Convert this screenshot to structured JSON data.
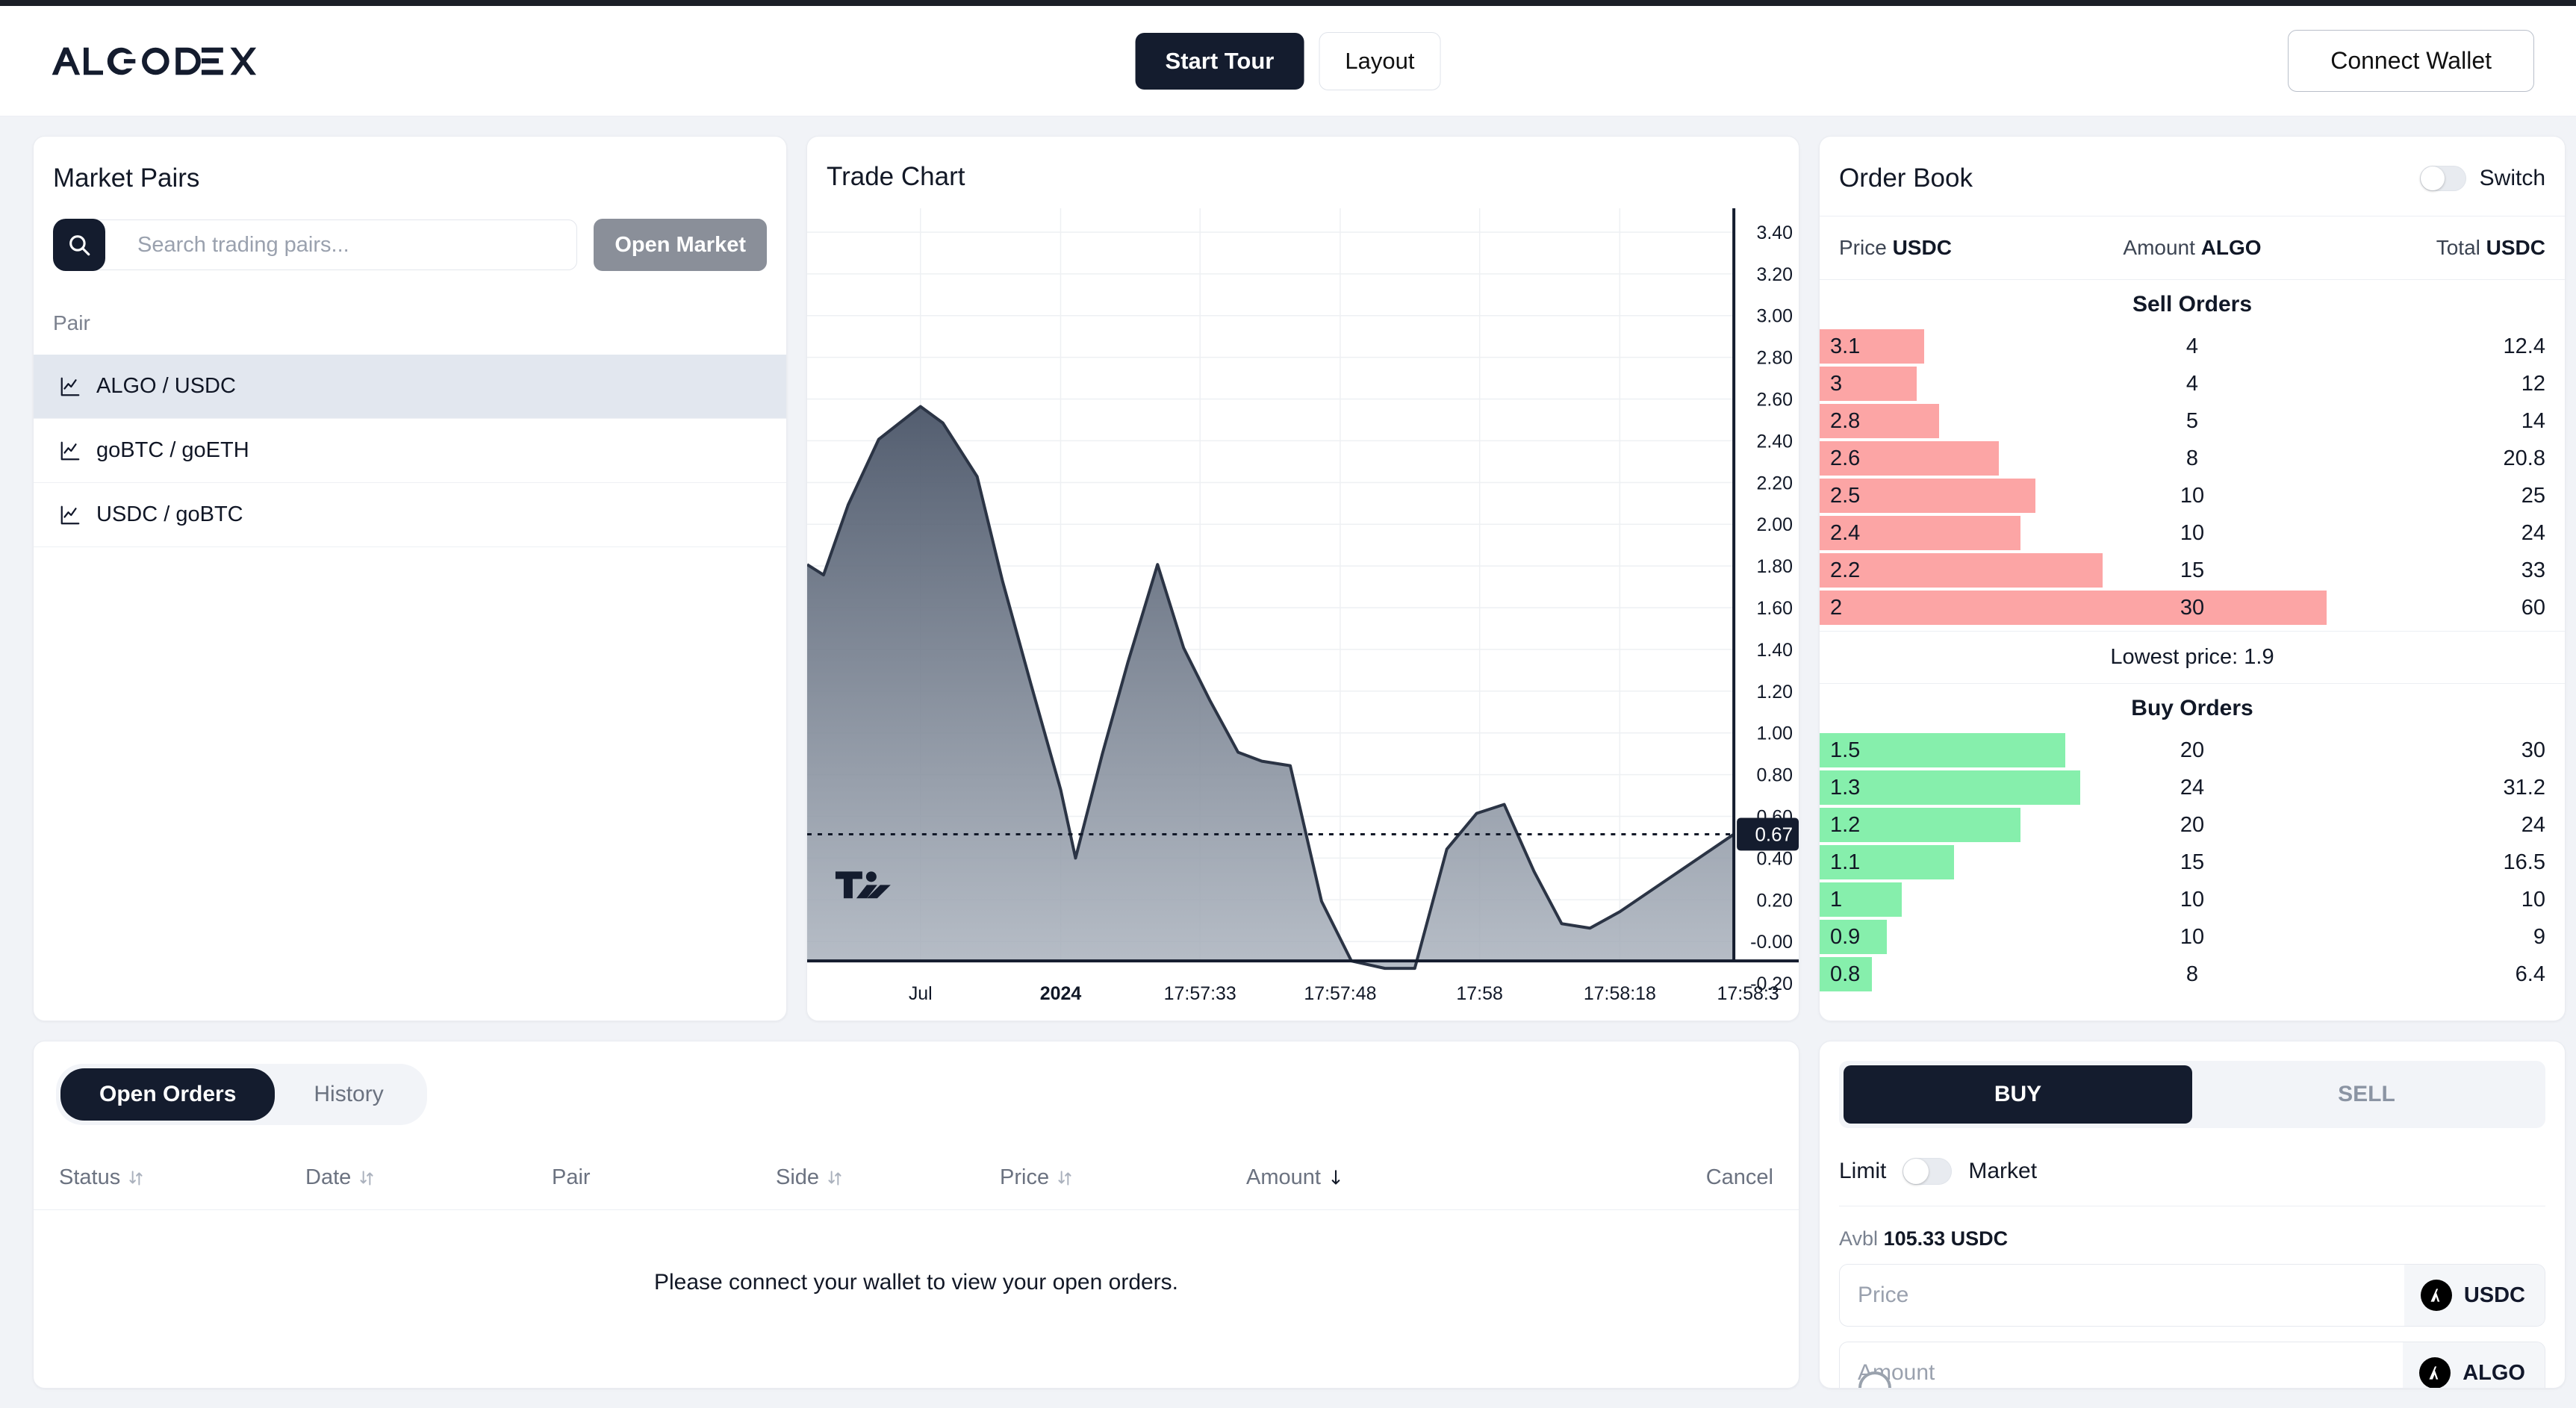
{
  "brand": {
    "name": "ALGODEX"
  },
  "header": {
    "start_tour": "Start Tour",
    "layout": "Layout",
    "connect_wallet": "Connect Wallet"
  },
  "market_pairs": {
    "title": "Market Pairs",
    "search_placeholder": "Search trading pairs...",
    "search_value": "",
    "open_market": "Open Market",
    "column_header": "Pair",
    "pairs": [
      {
        "label": "ALGO / USDC",
        "active": true
      },
      {
        "label": "goBTC / goETH",
        "active": false
      },
      {
        "label": "USDC / goBTC",
        "active": false
      }
    ]
  },
  "trade_chart": {
    "title": "Trade Chart",
    "attribution": "TradingView",
    "current_price_badge": "0.67"
  },
  "chart_data": {
    "type": "area",
    "title": "Trade Chart",
    "xlabel": "",
    "ylabel": "",
    "ylim": [
      -0.2,
      3.4
    ],
    "grid": true,
    "y_ticks": [
      "3.40",
      "3.20",
      "3.00",
      "2.80",
      "2.60",
      "2.40",
      "2.20",
      "2.00",
      "1.80",
      "1.60",
      "1.40",
      "1.20",
      "1.00",
      "0.80",
      "0.60",
      "0.40",
      "0.20",
      "-0.00",
      "-0.20"
    ],
    "x_ticks": [
      "Jul",
      "2024",
      "17:57:33",
      "17:57:48",
      "17:58",
      "17:58:18",
      "17:58:3"
    ],
    "price_line": 0.67,
    "series": [
      {
        "name": "ALGO / USDC",
        "values": [
          2.02,
          1.97,
          2.3,
          2.62,
          2.8,
          2.72,
          2.45,
          1.9,
          1.38,
          0.9,
          0.58,
          1.08,
          1.52,
          2.0,
          1.62,
          1.38,
          1.12,
          1.08,
          1.05,
          0.55,
          0.27,
          0.22,
          0.22,
          0.54,
          0.72,
          0.76,
          0.46,
          0.26,
          0.24,
          0.3,
          0.67
        ]
      }
    ]
  },
  "order_book": {
    "title": "Order Book",
    "switch_label": "Switch",
    "switch_on": false,
    "columns": {
      "price": "Price",
      "price_unit": "USDC",
      "amount": "Amount",
      "amount_unit": "ALGO",
      "total": "Total",
      "total_unit": "USDC"
    },
    "sell_title": "Sell Orders",
    "buy_title": "Buy Orders",
    "mid_label": "Lowest price: 1.9",
    "sell_orders": [
      {
        "price": "3.1",
        "amount": "4",
        "total": "12.4",
        "bar": 14
      },
      {
        "price": "3",
        "amount": "4",
        "total": "12",
        "bar": 13
      },
      {
        "price": "2.8",
        "amount": "5",
        "total": "14",
        "bar": 16
      },
      {
        "price": "2.6",
        "amount": "8",
        "total": "20.8",
        "bar": 24
      },
      {
        "price": "2.5",
        "amount": "10",
        "total": "25",
        "bar": 29
      },
      {
        "price": "2.4",
        "amount": "10",
        "total": "24",
        "bar": 27
      },
      {
        "price": "2.2",
        "amount": "15",
        "total": "33",
        "bar": 38
      },
      {
        "price": "2",
        "amount": "30",
        "total": "60",
        "bar": 68
      }
    ],
    "buy_orders": [
      {
        "price": "1.5",
        "amount": "20",
        "total": "30",
        "bar": 33
      },
      {
        "price": "1.3",
        "amount": "24",
        "total": "31.2",
        "bar": 35
      },
      {
        "price": "1.2",
        "amount": "20",
        "total": "24",
        "bar": 27
      },
      {
        "price": "1.1",
        "amount": "15",
        "total": "16.5",
        "bar": 18
      },
      {
        "price": "1",
        "amount": "10",
        "total": "10",
        "bar": 11
      },
      {
        "price": "0.9",
        "amount": "10",
        "total": "9",
        "bar": 9
      },
      {
        "price": "0.8",
        "amount": "8",
        "total": "6.4",
        "bar": 7
      }
    ]
  },
  "open_orders": {
    "tabs": [
      {
        "label": "Open Orders",
        "active": true
      },
      {
        "label": "History",
        "active": false
      }
    ],
    "columns": [
      {
        "label": "Status",
        "sort": "both"
      },
      {
        "label": "Date",
        "sort": "both"
      },
      {
        "label": "Pair",
        "sort": "none"
      },
      {
        "label": "Side",
        "sort": "both"
      },
      {
        "label": "Price",
        "sort": "both"
      },
      {
        "label": "Amount",
        "sort": "desc"
      },
      {
        "label": "Cancel",
        "sort": "none"
      }
    ],
    "empty_message": "Please connect your wallet to view your open orders."
  },
  "trade_form": {
    "tabs": [
      {
        "label": "BUY",
        "active": true
      },
      {
        "label": "SELL",
        "active": false
      }
    ],
    "limit_label": "Limit",
    "market_label": "Market",
    "order_type_on": false,
    "available_label": "Avbl",
    "available_value": "105.33 USDC",
    "price_placeholder": "Price",
    "price_value": "",
    "price_unit": "USDC",
    "amount_placeholder": "Amount",
    "amount_value": "",
    "amount_unit": "ALGO"
  },
  "colors": {
    "dark": "#141c2e",
    "sell": "#fca5a5",
    "buy": "#86efac",
    "page_bg": "#f1f3f7"
  }
}
